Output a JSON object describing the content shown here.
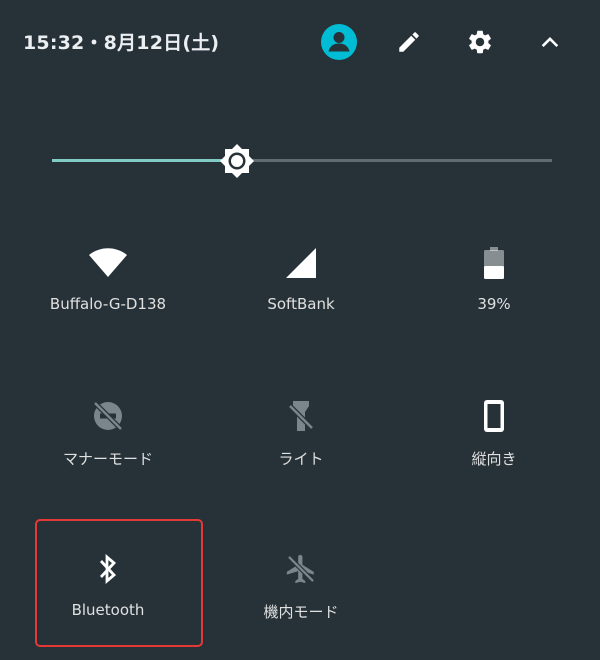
{
  "status": {
    "datetime": "15:32・8月12日(土)"
  },
  "header_icons": {
    "account": "account-circle-icon",
    "edit": "pencil-icon",
    "settings": "gear-icon",
    "collapse": "chevron-up-icon"
  },
  "colors": {
    "background": "#263238",
    "accent": "#00bcd4",
    "slider_fill": "#80cbc4",
    "highlight": "#e53935"
  },
  "brightness": {
    "level": 0.37
  },
  "tiles": [
    {
      "label": "Buffalo-G-D138",
      "icon": "wifi-icon",
      "active": true
    },
    {
      "label": "SoftBank",
      "icon": "cell-signal-icon",
      "active": true
    },
    {
      "label": "39%",
      "icon": "battery-icon",
      "active": true
    },
    {
      "label": "マナーモード",
      "icon": "do-not-disturb-off-icon",
      "active": false
    },
    {
      "label": "ライト",
      "icon": "flashlight-off-icon",
      "active": false
    },
    {
      "label": "縦向き",
      "icon": "portrait-orientation-icon",
      "active": true
    },
    {
      "label": "Bluetooth",
      "icon": "bluetooth-icon",
      "active": true
    },
    {
      "label": "機内モード",
      "icon": "airplane-mode-icon",
      "active": false
    }
  ]
}
